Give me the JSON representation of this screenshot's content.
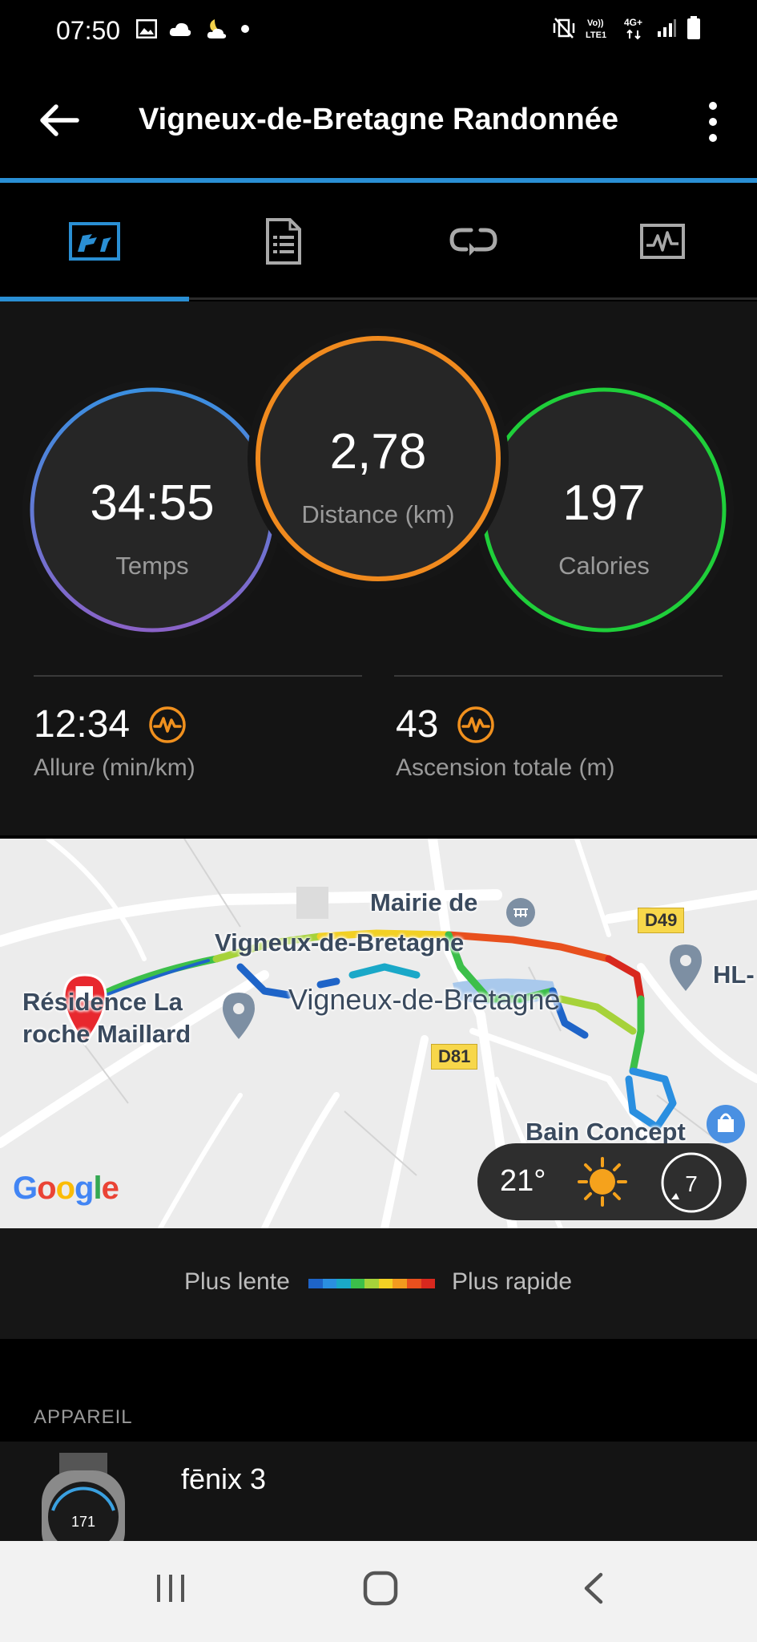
{
  "status_bar": {
    "time": "07:50",
    "icons_left": [
      "image-icon",
      "cloud-icon",
      "moon-cloud-icon",
      "dot-icon"
    ],
    "icons_right": [
      "mute-vibrate-icon",
      "volte-icon",
      "4g-icon",
      "signal-icon",
      "battery-icon"
    ],
    "volte_text": "Vo)) LTE1",
    "network_text": "4G+"
  },
  "app_bar": {
    "title": "Vigneux-de-Bretagne Randonnée"
  },
  "tabs": [
    {
      "icon": "summary-icon",
      "selected": true
    },
    {
      "icon": "details-icon",
      "selected": false
    },
    {
      "icon": "laps-icon",
      "selected": false
    },
    {
      "icon": "charts-icon",
      "selected": false
    }
  ],
  "stats": {
    "time": {
      "value": "34:55",
      "label": "Temps"
    },
    "distance": {
      "value": "2,78",
      "label": "Distance (km)"
    },
    "calories": {
      "value": "197",
      "label": "Calories"
    },
    "pace": {
      "value": "12:34",
      "label": "Allure (min/km)"
    },
    "ascent": {
      "value": "43",
      "label": "Ascension totale (m)"
    }
  },
  "map": {
    "places": {
      "mairie_line1": "Mairie de",
      "mairie_line2": "Vigneux-de-Bretagne",
      "residence_line1": "Résidence La",
      "residence_line2": "roche Maillard",
      "town": "Vigneux-de-Bretagne",
      "hl": "HL-",
      "bakery": "Bain Concept"
    },
    "roads": [
      "D49",
      "D81"
    ],
    "attribution": "Google",
    "weather": {
      "temperature": "21°",
      "condition_icon": "sun-icon",
      "wind": "7"
    }
  },
  "legend": {
    "slow_label": "Plus lente",
    "fast_label": "Plus rapide",
    "colors": [
      "#1e64c8",
      "#2a8fe0",
      "#1aa8c8",
      "#3cbf4a",
      "#a6d23a",
      "#f2d024",
      "#f29a1e",
      "#e8501e",
      "#d8281e"
    ]
  },
  "device": {
    "section_label": "APPAREIL",
    "name": "fēnix 3"
  },
  "colors": {
    "accent_blue": "#2a8fd4",
    "ring_time": "#3a8fe0",
    "ring_distance": "#f08a1e",
    "ring_calories": "#1fcf3a",
    "pace_icon": "#f0901e"
  }
}
